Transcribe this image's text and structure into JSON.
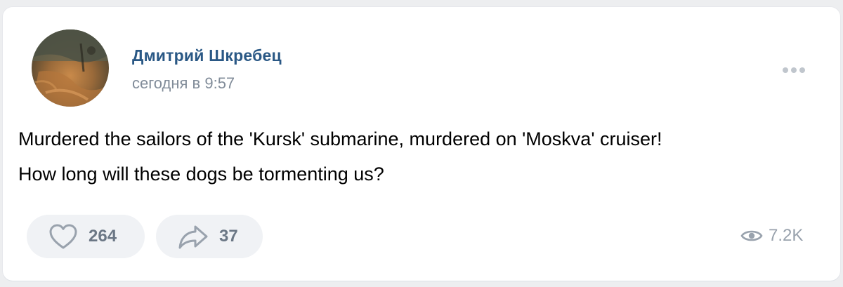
{
  "post": {
    "author": "Дмитрий Шкребец",
    "date": "сегодня в 9:57",
    "text_lines": [
      "Murdered the sailors of the 'Kursk' submarine, murdered on 'Moskva' cruiser!",
      "How long will these dogs be tormenting us?"
    ]
  },
  "actions": {
    "likes": "264",
    "shares": "37",
    "views": "7.2K"
  },
  "icons": {
    "like": "heart-icon",
    "share": "share-arrow-icon",
    "views": "eye-icon",
    "more": "more-dots-icon"
  },
  "colors": {
    "author": "#2a5885",
    "muted": "#818c99",
    "pill_bg": "#f0f2f5",
    "page_bg": "#edeef0"
  }
}
